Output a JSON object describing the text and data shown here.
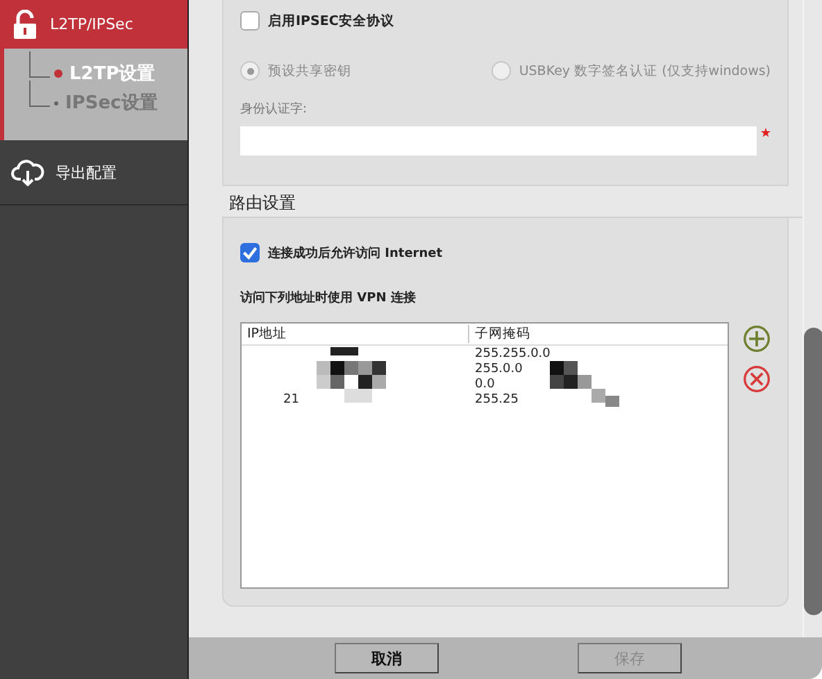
{
  "sidebar": {
    "items": [
      {
        "label": "L2TP/IPSec",
        "kind": "lock",
        "selected": true,
        "children": [
          {
            "label": "L2TP设置",
            "selected": true
          },
          {
            "label": "IPSec设置",
            "selected": false
          }
        ]
      },
      {
        "label": "导出配置",
        "kind": "cloud",
        "selected": false
      }
    ]
  },
  "ipsec": {
    "enable": {
      "label": "启用IPSEC安全协议",
      "checked": false
    },
    "auth_methods": [
      {
        "label": "预设共享密钥",
        "selected": true,
        "disabled": true
      },
      {
        "label": "USBKey 数字签名认证 (仅支持windows)",
        "selected": false,
        "disabled": true
      }
    ],
    "identity": {
      "label": "身份认证字:",
      "required": true
    }
  },
  "routing": {
    "title": "路由设置",
    "allow_internet": {
      "label": "连接成功后允许访问 Internet",
      "checked": true
    },
    "vpn_label": "访问下列地址时使用 VPN 连接",
    "table": {
      "columns": [
        "IP地址",
        "子网掩码"
      ],
      "rows": [
        {
          "ip": "",
          "mask": "255.255.0.0"
        },
        {
          "ip": "",
          "mask": "255.0.0"
        },
        {
          "ip": "",
          "mask": "0.0"
        },
        {
          "ip": "21",
          "mask": "255.25"
        }
      ]
    }
  },
  "buttons": [
    {
      "label": "取消",
      "disabled": false
    },
    {
      "label": "保存",
      "disabled": true
    }
  ]
}
